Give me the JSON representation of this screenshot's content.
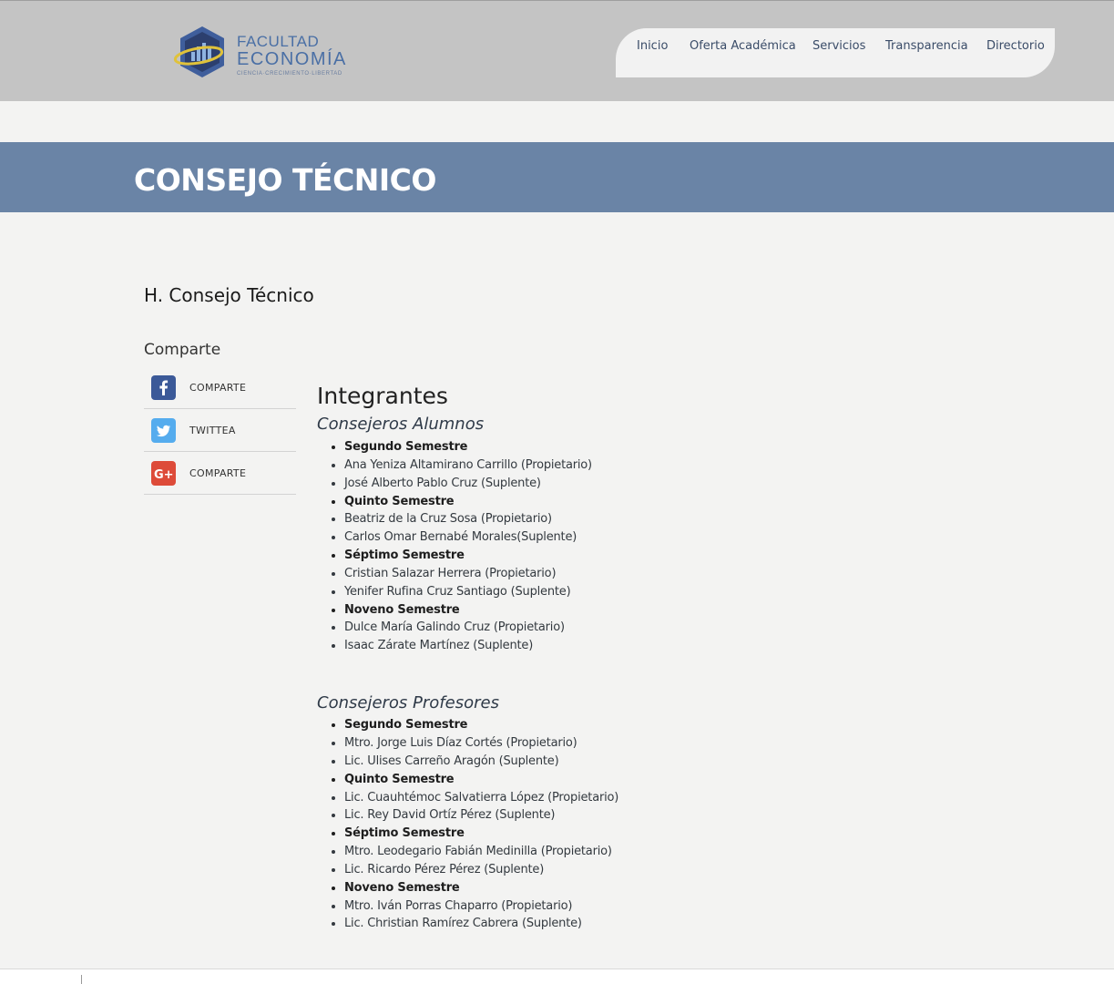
{
  "logo": {
    "line1": "FACULTAD",
    "line2": "ECONOMÍA",
    "tagline": "CIENCIA·CRECIMIENTO·LIBERTAD"
  },
  "nav": {
    "items": [
      "Inicio",
      "Oferta Académica",
      "Servicios",
      "Transparencia",
      "Directorio"
    ]
  },
  "banner": {
    "title": "CONSEJO TÉCNICO"
  },
  "page_heading": "H. Consejo Técnico",
  "share": {
    "heading": "Comparte",
    "items": [
      {
        "icon": "facebook-icon",
        "label": "COMPARTE",
        "color": "#3b5998"
      },
      {
        "icon": "twitter-icon",
        "label": "TWITTEA",
        "color": "#55acee"
      },
      {
        "icon": "google-plus-icon",
        "label": "COMPARTE",
        "color": "#dd4b39"
      }
    ]
  },
  "members": {
    "title": "Integrantes",
    "groups": [
      {
        "title": "Consejeros Alumnos",
        "items": [
          {
            "text": "Segundo Semestre",
            "bold": true
          },
          {
            "text": "Ana Yeniza Altamirano Carrillo (Propietario)"
          },
          {
            "text": "José Alberto Pablo Cruz (Suplente)"
          },
          {
            "text": "Quinto Semestre",
            "bold": true
          },
          {
            "text": "Beatriz de la Cruz Sosa (Propietario)"
          },
          {
            "text": "Carlos Omar Bernabé Morales(Suplente)"
          },
          {
            "text": "Séptimo Semestre",
            "bold": true
          },
          {
            "text": "Cristian Salazar Herrera (Propietario)"
          },
          {
            "text": "Yenifer Rufina Cruz Santiago (Suplente)"
          },
          {
            "text": "Noveno Semestre",
            "bold": true
          },
          {
            "text": "Dulce María Galindo Cruz (Propietario)"
          },
          {
            "text": "Isaac Zárate Martínez (Suplente)"
          }
        ]
      },
      {
        "title": "Consejeros Profesores",
        "items": [
          {
            "text": "Segundo Semestre",
            "bold": true
          },
          {
            "text": "Mtro. Jorge Luis Díaz Cortés (Propietario)"
          },
          {
            "text": "Lic. Ulises Carreño Aragón (Suplente)"
          },
          {
            "text": "Quinto Semestre",
            "bold": true
          },
          {
            "text": "Lic. Cuauhtémoc Salvatierra López (Propietario)"
          },
          {
            "text": "Lic. Rey David Ortíz Pérez (Suplente)"
          },
          {
            "text": "Séptimo Semestre",
            "bold": true
          },
          {
            "text": "Mtro. Leodegario Fabián Medinilla (Propietario)"
          },
          {
            "text": "Lic. Ricardo Pérez Pérez (Suplente)"
          },
          {
            "text": "Noveno Semestre",
            "bold": true
          },
          {
            "text": "Mtro. Iván Porras Chaparro (Propietario)"
          },
          {
            "text": "Lic. Christian Ramírez Cabrera (Suplente)"
          }
        ]
      }
    ]
  }
}
